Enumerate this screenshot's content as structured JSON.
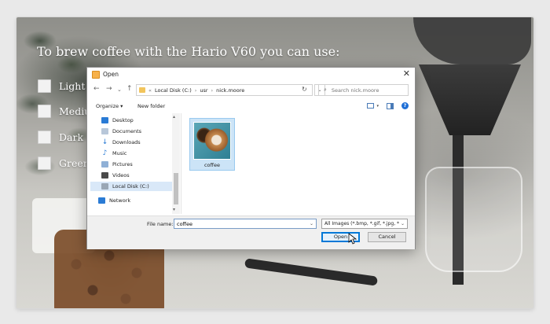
{
  "page": {
    "heading": "To brew coffee with the Hario V60 you can use:",
    "options": [
      {
        "label": "Light ro"
      },
      {
        "label": "Medium"
      },
      {
        "label": "Dark ro"
      },
      {
        "label": "Green c"
      }
    ]
  },
  "dialog": {
    "title": "Open",
    "close_glyph": "✕",
    "address": {
      "prefix": "«",
      "crumbs": [
        "Local Disk (C:)",
        "usr",
        "nick.moore"
      ],
      "separator": "›"
    },
    "search_placeholder": "Search nick.moore",
    "toolbar": {
      "organize": "Organize ▾",
      "new_folder": "New folder"
    },
    "nav_items": [
      {
        "label": "Desktop",
        "icon": "desktop-icon",
        "color": "#2a7bd5"
      },
      {
        "label": "Documents",
        "icon": "documents-icon",
        "color": "#b8c7d9"
      },
      {
        "label": "Downloads",
        "icon": "downloads-icon",
        "color": "#2a7bd5"
      },
      {
        "label": "Music",
        "icon": "music-icon",
        "color": "#2a7bd5"
      },
      {
        "label": "Pictures",
        "icon": "pictures-icon",
        "color": "#8fb0d6"
      },
      {
        "label": "Videos",
        "icon": "videos-icon",
        "color": "#4a4a4a"
      },
      {
        "label": "Local Disk (C:)",
        "icon": "local-disk-icon",
        "color": "#9aa7b5",
        "selected": true
      },
      {
        "label": "Network",
        "icon": "network-icon",
        "color": "#2a7bd5"
      }
    ],
    "files": [
      {
        "label": "coffee"
      }
    ],
    "file_name_label": "File name:",
    "file_name_value": "coffee",
    "file_type": "All Images (*.bmp, *.gif, *.jpg, *",
    "open_label": "Open",
    "cancel_label": "Cancel"
  }
}
